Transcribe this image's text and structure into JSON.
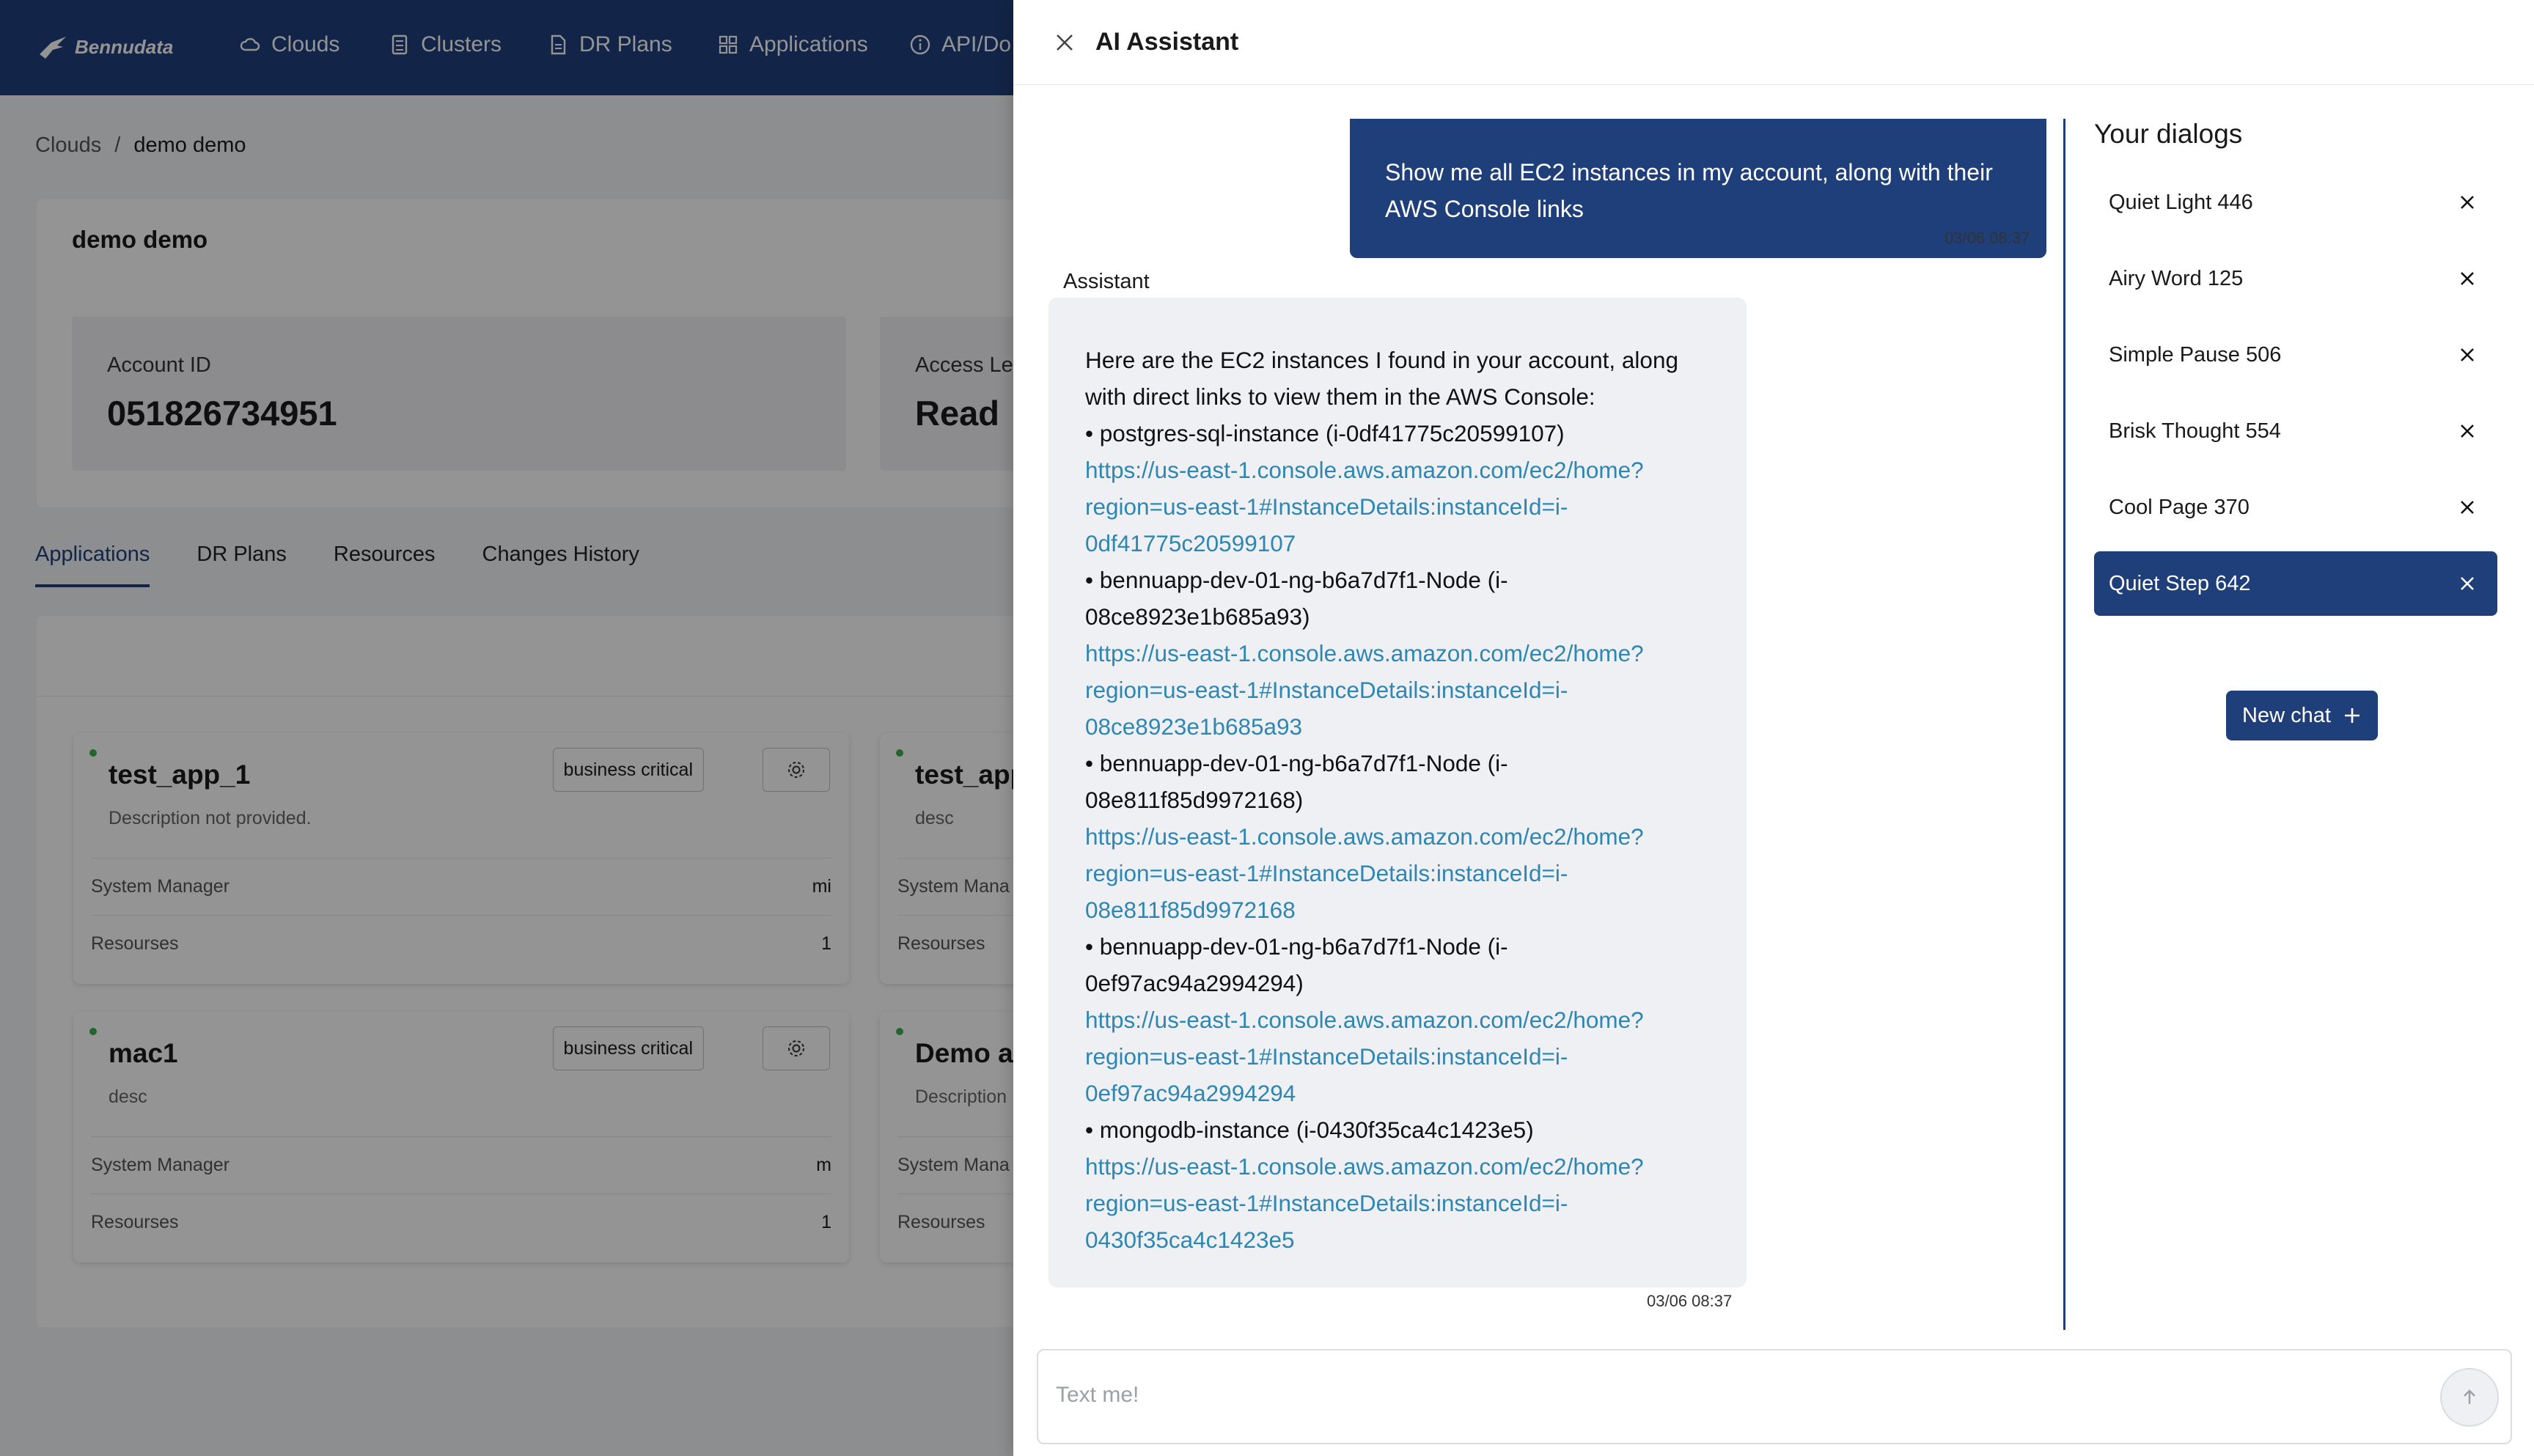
{
  "app": {
    "logo_text": "Bennudata",
    "nav": [
      "Clouds",
      "Clusters",
      "DR Plans",
      "Applications",
      "API/Do"
    ],
    "breadcrumb": {
      "root": "Clouds",
      "separator": "/",
      "current": "demo demo"
    },
    "cloud_title": "demo demo",
    "account": {
      "label": "Account ID",
      "value": "051826734951"
    },
    "access": {
      "label": "Access Le",
      "value": "Read"
    },
    "tabs": [
      "Applications",
      "DR Plans",
      "Resources",
      "Changes History"
    ],
    "cards": [
      {
        "name": "test_app_1",
        "desc": "Description not provided.",
        "badge": "business critical",
        "row1_label": "System Manager",
        "row1_value": "mi",
        "row2_label": "Resourses",
        "row2_value": "1"
      },
      {
        "name": "test_app",
        "desc": "desc",
        "row1_label": "System Mana",
        "row2_label": "Resourses"
      },
      {
        "name": "mac1",
        "desc": "desc",
        "badge": "business critical",
        "row1_label": "System Manager",
        "row1_value": "m",
        "row2_label": "Resourses",
        "row2_value": "1"
      },
      {
        "name": "Demo a",
        "desc": "Description",
        "row1_label": "System Mana",
        "row2_label": "Resourses"
      }
    ],
    "brand_color": "#1f3f7a",
    "status_color": "#3fae4d"
  },
  "assistant": {
    "title": "AI Assistant",
    "user_message": [
      "Show me all EC2 instances in my account, along with their",
      "AWS Console links"
    ],
    "user_time": "03/06 08:37",
    "sender": "Assistant",
    "reply_lines": [
      {
        "text": "Here are the EC2 instances I found in your account, along",
        "link": false
      },
      {
        "text": "with direct links to view them in the AWS Console:",
        "link": false
      },
      {
        "text": "• postgres-sql-instance (i-0df41775c20599107)",
        "link": false
      },
      {
        "text": "https://us-east-1.console.aws.amazon.com/ec2/home?",
        "link": true
      },
      {
        "text": "region=us-east-1#InstanceDetails:instanceId=i-",
        "link": true
      },
      {
        "text": "0df41775c20599107",
        "link": true
      },
      {
        "text": "• bennuapp-dev-01-ng-b6a7d7f1-Node (i-",
        "link": false
      },
      {
        "text": "08ce8923e1b685a93)",
        "link": false
      },
      {
        "text": "https://us-east-1.console.aws.amazon.com/ec2/home?",
        "link": true
      },
      {
        "text": "region=us-east-1#InstanceDetails:instanceId=i-",
        "link": true
      },
      {
        "text": "08ce8923e1b685a93",
        "link": true
      },
      {
        "text": "• bennuapp-dev-01-ng-b6a7d7f1-Node (i-",
        "link": false
      },
      {
        "text": "08e811f85d9972168)",
        "link": false
      },
      {
        "text": "https://us-east-1.console.aws.amazon.com/ec2/home?",
        "link": true
      },
      {
        "text": "region=us-east-1#InstanceDetails:instanceId=i-",
        "link": true
      },
      {
        "text": "08e811f85d9972168",
        "link": true
      },
      {
        "text": "• bennuapp-dev-01-ng-b6a7d7f1-Node (i-",
        "link": false
      },
      {
        "text": "0ef97ac94a2994294)",
        "link": false
      },
      {
        "text": "https://us-east-1.console.aws.amazon.com/ec2/home?",
        "link": true
      },
      {
        "text": "region=us-east-1#InstanceDetails:instanceId=i-",
        "link": true
      },
      {
        "text": "0ef97ac94a2994294",
        "link": true
      },
      {
        "text": "• mongodb-instance (i-0430f35ca4c1423e5)",
        "link": false
      },
      {
        "text": "https://us-east-1.console.aws.amazon.com/ec2/home?",
        "link": true
      },
      {
        "text": "region=us-east-1#InstanceDetails:instanceId=i-",
        "link": true
      },
      {
        "text": "0430f35ca4c1423e5",
        "link": true
      }
    ],
    "reply_time": "03/06 08:37",
    "dialogs_heading": "Your dialogs",
    "dialogs": [
      {
        "label": "Quiet Light 446",
        "active": false
      },
      {
        "label": "Airy Word 125",
        "active": false
      },
      {
        "label": "Simple Pause 506",
        "active": false
      },
      {
        "label": "Brisk Thought 554",
        "active": false
      },
      {
        "label": "Cool Page 370",
        "active": false
      },
      {
        "label": "Quiet Step 642",
        "active": true
      }
    ],
    "new_chat_label": "New chat",
    "input_placeholder": "Text me!",
    "link_color": "#2f86b3"
  }
}
